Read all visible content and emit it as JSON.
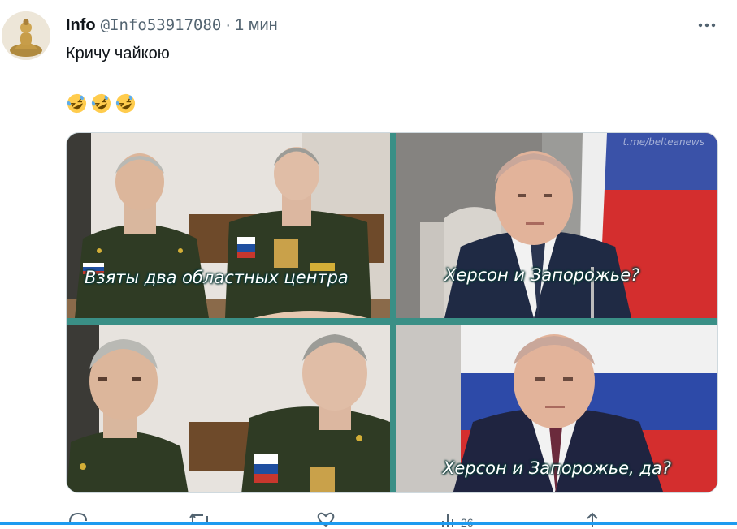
{
  "tweet": {
    "author_name": "Info",
    "handle": "@Info53917080",
    "separator": "·",
    "time": "1 мин",
    "text": "Кричу чайкою",
    "emoji_count": 3
  },
  "meme": {
    "watermark": "t.me/belteanews",
    "captions": {
      "top_left": "Взяты два областных центра",
      "top_right": "Херсон и Запорожье?",
      "bottom_right": "Херсон и Запорожье, да?"
    }
  },
  "actions": {
    "views_count": "26"
  },
  "colors": {
    "accent": "#1d9bf0",
    "meme_divider": "#3a8f86"
  }
}
